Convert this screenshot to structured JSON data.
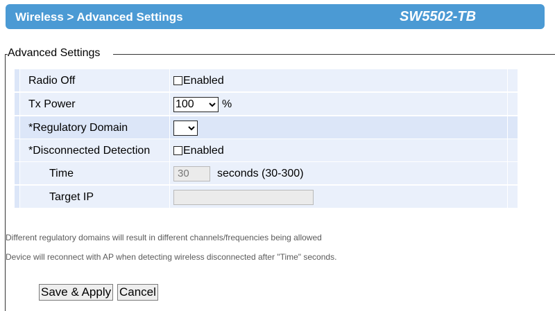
{
  "header": {
    "breadcrumb": "Wireless > Advanced Settings",
    "model": "SW5502-TB",
    "bg_color": "#4b9ad4"
  },
  "section": {
    "legend": "Advanced Settings"
  },
  "rows": {
    "radio_off": {
      "label": "Radio Off",
      "checkbox_label": "Enabled",
      "checked": false
    },
    "tx_power": {
      "label": "Tx Power",
      "value": "100",
      "unit": "%"
    },
    "regulatory_domain": {
      "label": "*Regulatory Domain",
      "value": ""
    },
    "disconnected_detection": {
      "label": "*Disconnected Detection",
      "checkbox_label": "Enabled",
      "checked": false
    },
    "time": {
      "label": "Time",
      "value": "30",
      "suffix": "seconds (30-300)"
    },
    "target_ip": {
      "label": "Target IP",
      "value": ""
    }
  },
  "notes": [
    "Different regulatory domains will result in different channels/frequencies being allowed",
    "Device will reconnect with AP when detecting wireless disconnected after \"Time\" seconds."
  ],
  "buttons": {
    "save": "Save & Apply",
    "cancel": "Cancel"
  }
}
